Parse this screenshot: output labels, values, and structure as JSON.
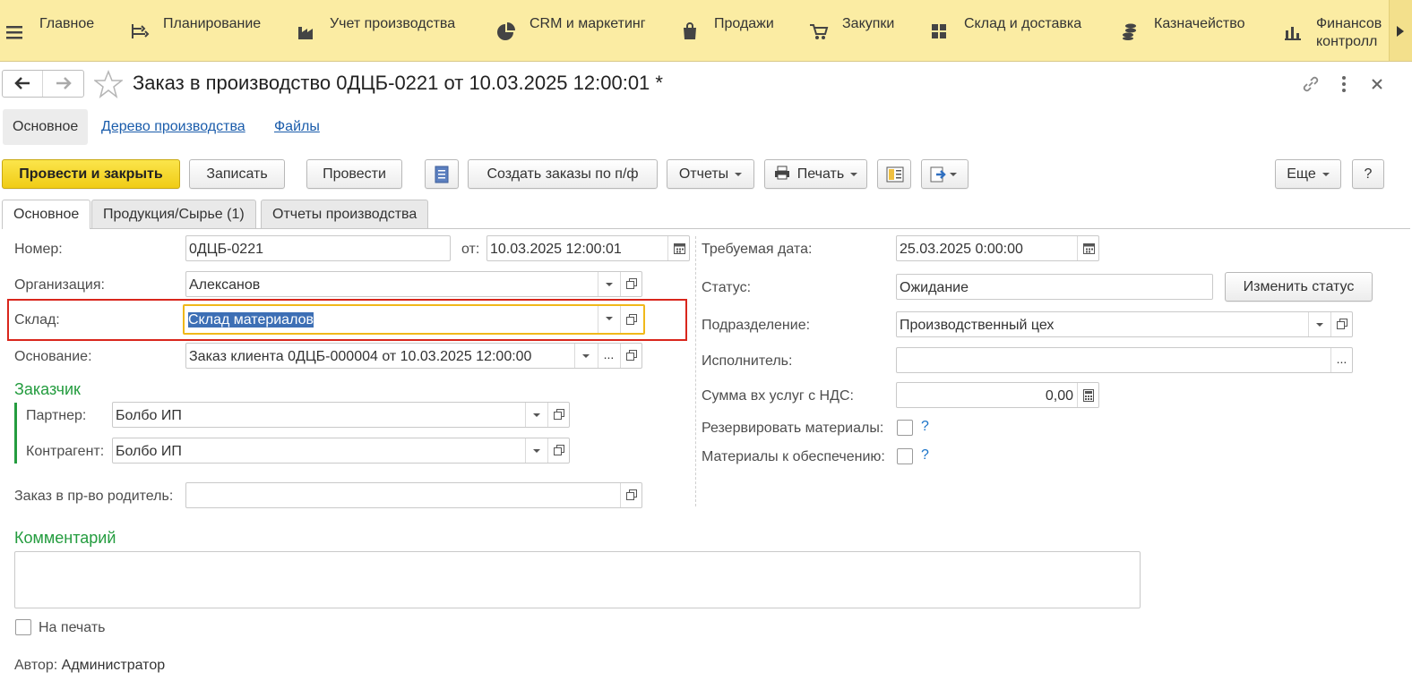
{
  "sections": [
    {
      "label": "Главное",
      "icon": "hamburger-icon"
    },
    {
      "label": "Планирование",
      "icon": "planning-icon"
    },
    {
      "label": "Учет производства",
      "icon": "factory-icon"
    },
    {
      "label": "CRM и маркетинг",
      "icon": "pie-chart-icon"
    },
    {
      "label": "Продажи",
      "icon": "shopping-bag-icon"
    },
    {
      "label": "Закупки",
      "icon": "cart-icon"
    },
    {
      "label": "Склад и доставка",
      "icon": "warehouse-icon"
    },
    {
      "label": "Казначейство",
      "icon": "coins-icon"
    },
    {
      "label": "Финансов",
      "label2": "контролл",
      "icon": "bar-chart-icon"
    }
  ],
  "header": {
    "title": "Заказ в производство 0ДЦБ-0221 от 10.03.2025 12:00:01 *"
  },
  "form_nav": {
    "main": "Основное",
    "tree": "Дерево производства",
    "files": "Файлы"
  },
  "toolbar": {
    "post_close": "Провести и закрыть",
    "save": "Записать",
    "post": "Провести",
    "create_orders": "Создать заказы по п/ф",
    "reports": "Отчеты",
    "print": "Печать",
    "more": "Еще",
    "help": "?"
  },
  "tabs": {
    "main": "Основное",
    "products": "Продукция/Сырье (1)",
    "reports": "Отчеты производства"
  },
  "form": {
    "number_label": "Номер:",
    "number": "0ДЦБ-0221",
    "from_label": "от:",
    "date": "10.03.2025 12:00:01",
    "org_label": "Организация:",
    "org": "Алексанов",
    "warehouse_label": "Склад:",
    "warehouse": "Склад материалов",
    "basis_label": "Основание:",
    "basis": "Заказ клиента 0ДЦБ-000004 от 10.03.2025 12:00:00",
    "customer_header": "Заказчик",
    "partner_label": "Партнер:",
    "partner": "Болбо ИП",
    "counterparty_label": "Контрагент:",
    "counterparty": "Болбо ИП",
    "parent_label": "Заказ в пр-во родитель:",
    "parent": "",
    "required_date_label": "Требуемая дата:",
    "required_date": "25.03.2025  0:00:00",
    "status_label": "Статус:",
    "status": "Ожидание",
    "change_status": "Изменить статус",
    "division_label": "Подразделение:",
    "division": "Производственный цех",
    "executor_label": "Исполнитель:",
    "executor": "",
    "sum_label": "Сумма вх услуг с НДС:",
    "sum": "0,00",
    "reserve_label": "Резервировать материалы:",
    "reserve_help": "?",
    "provide_label": "Материалы к обеспечению:",
    "provide_help": "?",
    "comment_header": "Комментарий",
    "comment": "",
    "print_label": "На печать",
    "author_label": "Автор:",
    "author": "Администратор"
  },
  "colors": {
    "top_panel": "#fbeca3",
    "primary_button": "#f5d830",
    "highlight_red": "#d9261c",
    "focus_orange": "#f0b81a",
    "group_green": "#249c3f",
    "link_blue": "#1a5cab"
  }
}
